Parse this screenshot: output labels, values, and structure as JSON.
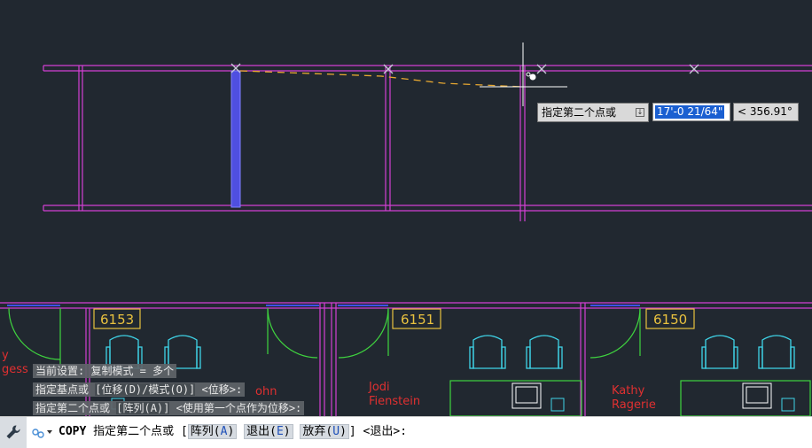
{
  "canvas": {
    "room_numbers": [
      "6153",
      "6151",
      "6150"
    ],
    "labels": {
      "jodi": [
        "Jodi",
        "Fienstein"
      ],
      "kathy": [
        "Kathy",
        "Ragerie"
      ],
      "left_partial": [
        "y",
        "gess"
      ],
      "john_partial": "ohn"
    },
    "colors": {
      "background": "#212830",
      "wall": "#d43fd4",
      "selected": "#4f4fe0",
      "door": "#3fd43f",
      "chair": "#3fd4e8",
      "room_tag": "#e8c13f",
      "name_text": "#e03030",
      "rubber_band": "#e8a830"
    }
  },
  "dynamic_input": {
    "prompt": "指定第二个点或",
    "distance": "17'-0 21/64\"",
    "angle": "< 356.91°"
  },
  "history": {
    "line1": "当前设置:  复制模式 = 多个",
    "line2_main": "指定基点或",
    "line2_opt": "[位移(D)/模式(O)]",
    "line2_tail": "<位移>:",
    "line3_main": "指定第二个点或",
    "line3_opt": "[阵列(A)]",
    "line3_tail": "<使用第一个点作为位移>:"
  },
  "command_line": {
    "command": "COPY",
    "prompt": "指定第二个点或 [",
    "options": [
      {
        "label": "阵列(",
        "key": "A",
        "end": ")"
      },
      {
        "label": "退出(",
        "key": "E",
        "end": ")"
      },
      {
        "label": "放弃(",
        "key": "U",
        "end": ")"
      }
    ],
    "tail": "] <退出>:",
    "icons": [
      "wrench-icon",
      "recent-commands-icon"
    ]
  }
}
